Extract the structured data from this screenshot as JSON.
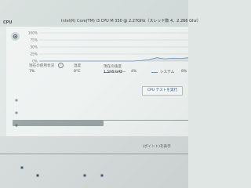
{
  "header": {
    "section_label": "CPU",
    "cpu_name": "Intel(R) Core(TM) i3 CPU M 350 @ 2.27GHz（スレッド数 4、2.266 Ghz）"
  },
  "chart_data": {
    "type": "area",
    "ylabels": [
      "100%",
      "75%",
      "50%",
      "25%",
      "0%"
    ],
    "ylim": [
      0,
      100
    ],
    "grid": true,
    "series": [
      {
        "name": "ユーザー",
        "x": [
          0,
          1,
          2,
          3,
          4,
          5,
          6,
          7,
          8,
          9,
          10,
          11,
          12,
          13,
          14,
          15,
          16,
          17,
          18,
          19
        ],
        "values": [
          0,
          0,
          0,
          0,
          0,
          0,
          0,
          0,
          0,
          0,
          0,
          0,
          0,
          2,
          5,
          12,
          8,
          10,
          9,
          12
        ]
      }
    ]
  },
  "legend": {
    "user_label": "ユーザー",
    "user_value": "4%",
    "system_label": "システム",
    "system_value": "8%"
  },
  "info": {
    "col1_label": "現在の使用状況",
    "col1_value": "7%",
    "col2_label": "温度",
    "col2_value": "0°C",
    "col3_label": "現在の速度",
    "col3_value": "1.596 GHz"
  },
  "actions": {
    "cpu_test_button": "CPU テストを実行",
    "footer_link": "(ポイント)を表示"
  },
  "colors": {
    "accent_line": "#6f8fb0",
    "panel_bg": "#eef2f1"
  }
}
